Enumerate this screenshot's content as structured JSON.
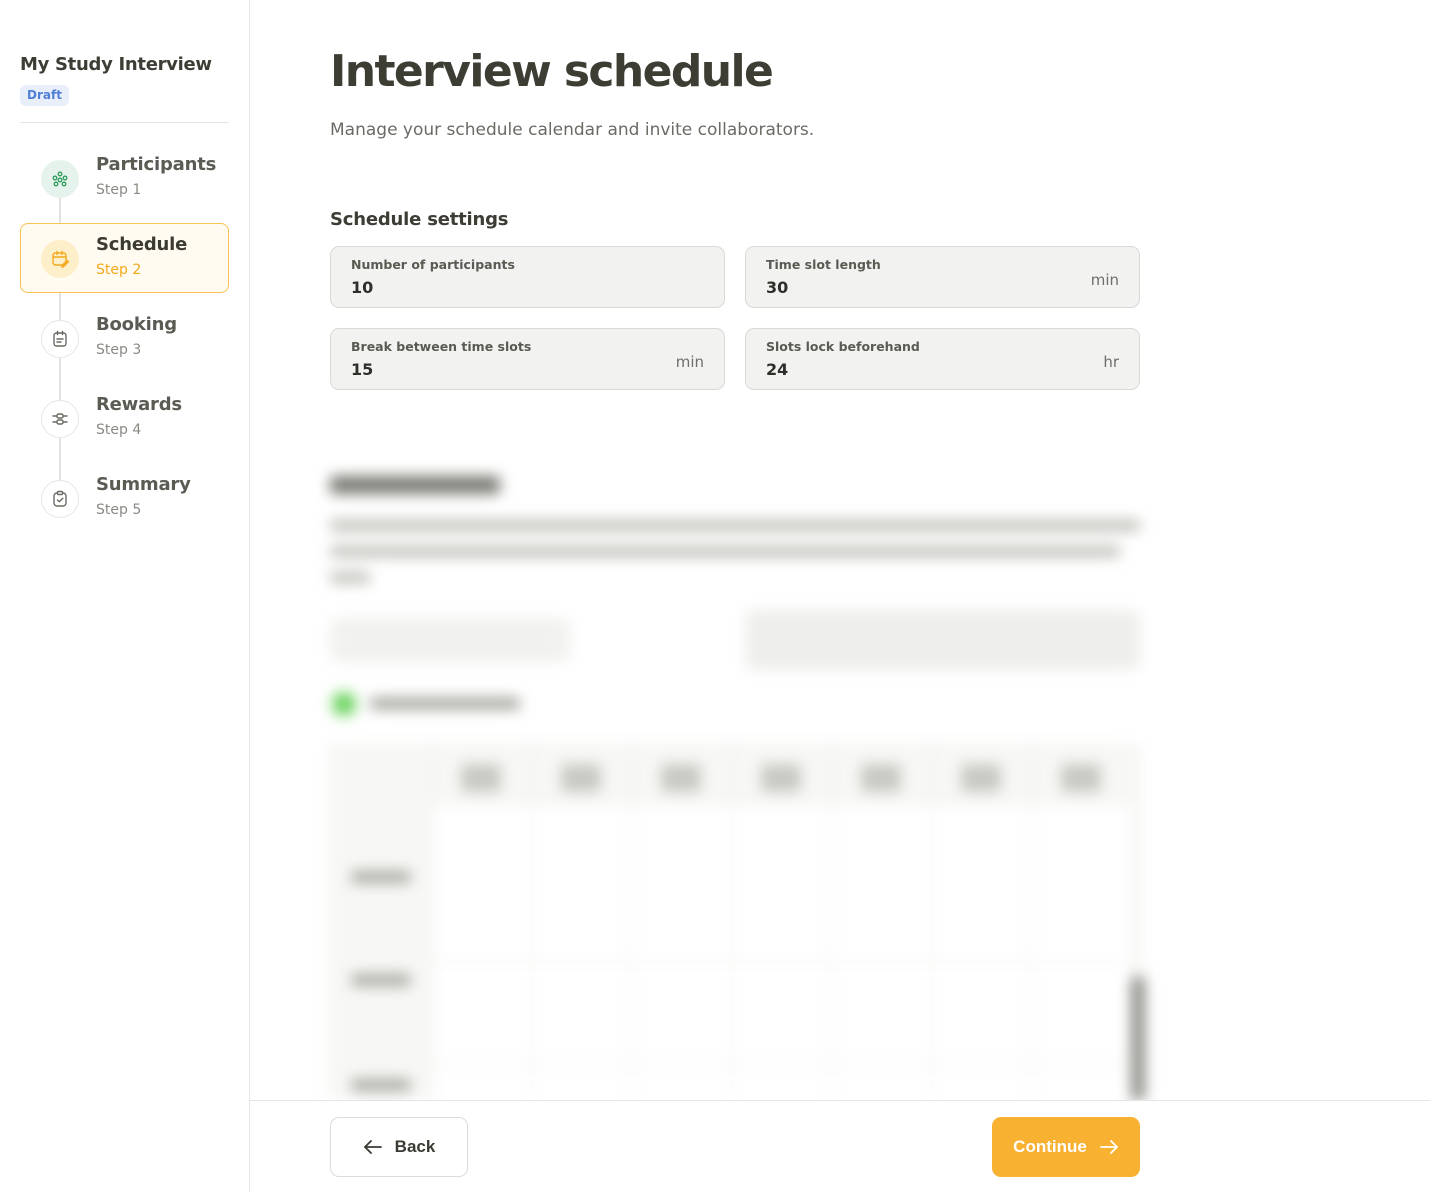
{
  "sidebar": {
    "study_title": "My Study Interview",
    "status": "Draft",
    "steps": [
      {
        "label": "Participants",
        "sub": "Step 1",
        "icon": "participants-icon"
      },
      {
        "label": "Schedule",
        "sub": "Step 2",
        "icon": "calendar-edit-icon"
      },
      {
        "label": "Booking",
        "sub": "Step 3",
        "icon": "calendar-icon"
      },
      {
        "label": "Rewards",
        "sub": "Step 4",
        "icon": "sliders-icon"
      },
      {
        "label": "Summary",
        "sub": "Step 5",
        "icon": "clipboard-check-icon"
      }
    ]
  },
  "main": {
    "title": "Interview schedule",
    "subtitle": "Manage your schedule calendar and invite collaborators.",
    "section_title": "Schedule settings",
    "fields": [
      {
        "label": "Number of participants",
        "value": "10",
        "unit": ""
      },
      {
        "label": "Time slot length",
        "value": "30",
        "unit": "min"
      },
      {
        "label": "Break between time slots",
        "value": "15",
        "unit": "min"
      },
      {
        "label": "Slots lock beforehand",
        "value": "24",
        "unit": "hr"
      }
    ]
  },
  "footer": {
    "back_label": "Back",
    "continue_label": "Continue"
  },
  "colors": {
    "accent": "#f9b132",
    "active_step_border": "#f6c452",
    "badge_text": "#4f7fd6",
    "badge_bg": "#e8effb",
    "completed_step": "#2f9b5c"
  }
}
